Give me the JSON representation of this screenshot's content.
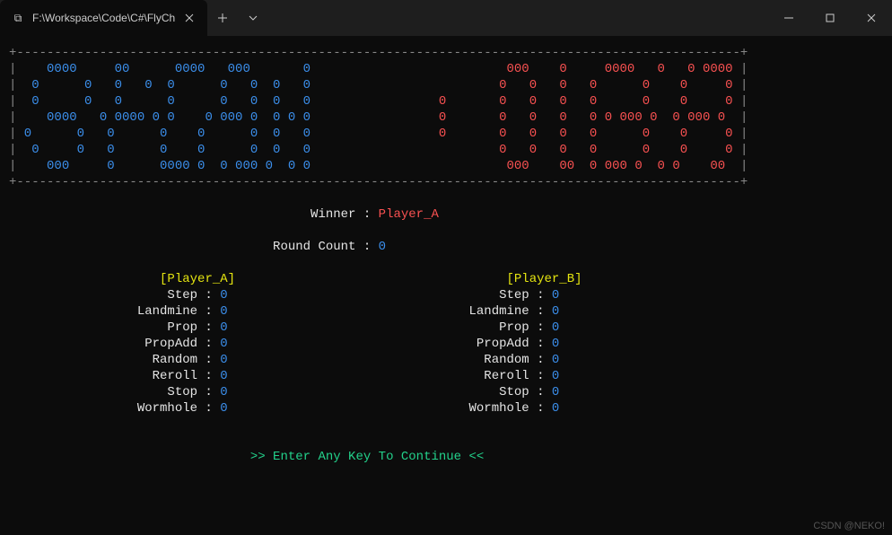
{
  "titlebar": {
    "tab_title": "F:\\Workspace\\Code\\C#\\FlyCh",
    "tab_icon": "⧉"
  },
  "border_dash": "+------------------------------------------------------------------------------------------------+",
  "art_blue": [
    "|    0000     00      0000   000       0 ",
    "|  0      0   0   0  0      0   0  0   0 ",
    "|  0      0   0      0      0   0  0   0 ",
    "|    0000   0 0000 0 0    0 000 0  0 0 0 ",
    "| 0      0   0      0    0      0  0   0 ",
    "|  0     0   0      0    0      0  0   0 ",
    "|    000     0      0000 0  0 000 0  0 0 "
  ],
  "art_red": [
    "         000    0     0000   0   0 0000 |",
    "        0   0   0   0      0    0     0 |",
    "0       0   0   0   0      0    0     0 |",
    "0       0   0   0   0 0 000 0  0 000 0  |",
    "0       0   0   0   0      0    0     0 |",
    "        0   0   0   0      0    0     0 |",
    "         000    00  0 000 0  0 0    00  |"
  ],
  "winner_label": "Winner : ",
  "winner_value": "Player_A",
  "round_label": "Round Count : ",
  "round_value": "0",
  "playerA": {
    "name": "[Player_A]",
    "stats": [
      {
        "label": "Step : ",
        "value": "0"
      },
      {
        "label": "Landmine : ",
        "value": "0"
      },
      {
        "label": "Prop : ",
        "value": "0"
      },
      {
        "label": "PropAdd : ",
        "value": "0"
      },
      {
        "label": "Random : ",
        "value": "0"
      },
      {
        "label": "Reroll : ",
        "value": "0"
      },
      {
        "label": "Stop : ",
        "value": "0"
      },
      {
        "label": "Wormhole : ",
        "value": "0"
      }
    ]
  },
  "playerB": {
    "name": "[Player_B]",
    "stats": [
      {
        "label": "Step : ",
        "value": "0"
      },
      {
        "label": "Landmine : ",
        "value": "0"
      },
      {
        "label": "Prop : ",
        "value": "0"
      },
      {
        "label": "PropAdd : ",
        "value": "0"
      },
      {
        "label": "Random : ",
        "value": "0"
      },
      {
        "label": "Reroll : ",
        "value": "0"
      },
      {
        "label": "Stop : ",
        "value": "0"
      },
      {
        "label": "Wormhole : ",
        "value": "0"
      }
    ]
  },
  "continue_prompt": ">> Enter Any Key To Continue <<",
  "watermark": "CSDN @NEKO!"
}
